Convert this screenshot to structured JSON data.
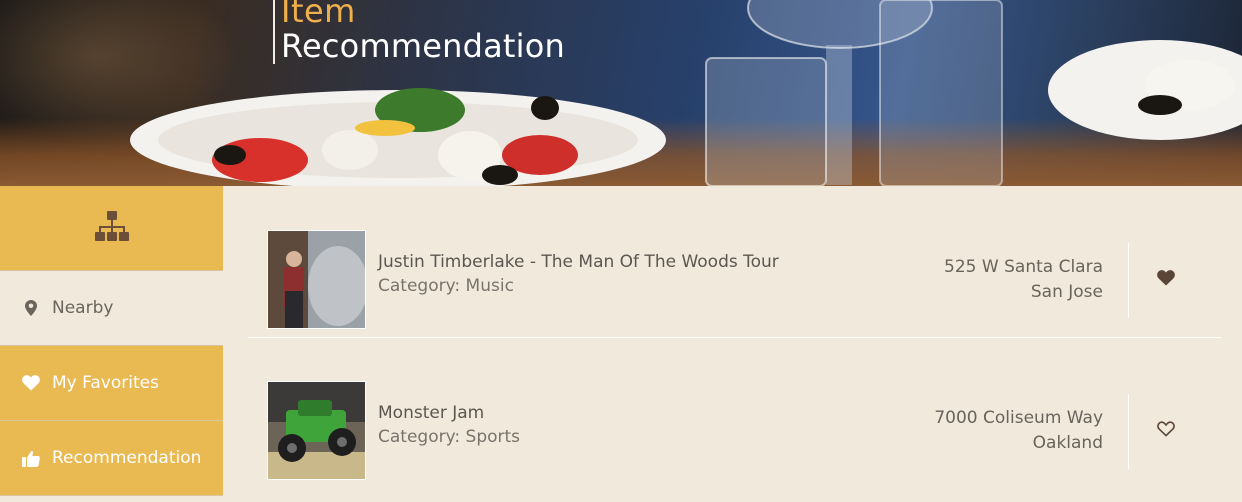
{
  "header": {
    "title_line1": "Item",
    "title_line2": "Recommendation"
  },
  "sidebar": {
    "top_icon": "sitemap-icon",
    "items": [
      {
        "label": "Nearby",
        "icon": "map-pin-icon",
        "active": false
      },
      {
        "label": "My Favorites",
        "icon": "heart-icon",
        "active": true
      },
      {
        "label": "Recommendation",
        "icon": "thumbs-up-icon",
        "active": true
      }
    ]
  },
  "items": [
    {
      "name": "Justin Timberlake - The Man Of The Woods Tour",
      "category": "Category: Music",
      "address_line1": "525 W Santa Clara",
      "address_line2": "San Jose",
      "favorite": true,
      "favorite_icon": "heart-filled-icon"
    },
    {
      "name": "Monster Jam",
      "category": "Category: Sports",
      "address_line1": "7000 Coliseum Way",
      "address_line2": "Oakland",
      "favorite": false,
      "favorite_icon": "heart-outline-icon"
    }
  ],
  "colors": {
    "accent_gold": "#e9b952",
    "title_orange": "#efb04c",
    "background": "#f1e9dc",
    "icon_brown": "#6b4f38"
  }
}
